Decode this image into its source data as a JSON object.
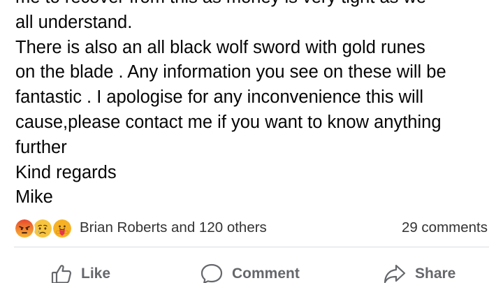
{
  "post": {
    "lines": [
      "me to recover from this as money is very tight as we",
      "all understand.",
      "There is also an all black wolf sword with gold runes",
      "on the blade . Any information you see on these will be",
      "fantastic . I apologise for any inconvenience this will",
      "cause,please contact me if you want to know anything",
      "further",
      "Kind regards",
      "Mike"
    ]
  },
  "reactions": {
    "icons": [
      "angry-reaction",
      "sad-reaction",
      "care-reaction"
    ],
    "summary": "Brian Roberts and 120 others",
    "comments": "29 comments"
  },
  "actions": {
    "like_label": "Like",
    "comment_label": "Comment",
    "share_label": "Share"
  },
  "colors": {
    "text": "#050505",
    "secondary_text": "#65676b",
    "divider": "#dadde1",
    "angry": "#f0642d",
    "sad": "#f7c43f",
    "care": "#f7b125"
  }
}
